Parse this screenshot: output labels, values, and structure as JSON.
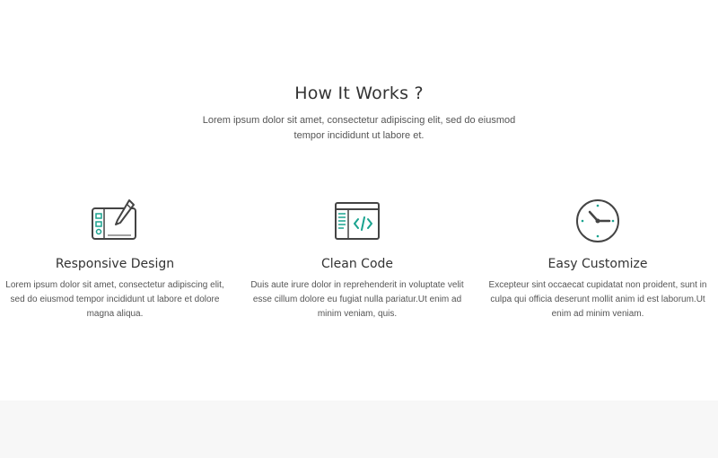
{
  "section": {
    "title": "How It Works ?",
    "lead": "Lorem ipsum dolor sit amet, consectetur adipiscing elit, sed do eiusmod tempor incididunt ut labore et."
  },
  "features": [
    {
      "icon": "tablet-pen-icon",
      "title": "Responsive Design",
      "text": "Lorem ipsum dolor sit amet, consectetur adipiscing elit, sed do eiusmod tempor incididunt ut labore et dolore magna aliqua."
    },
    {
      "icon": "code-window-icon",
      "title": "Clean Code",
      "text": "Duis aute irure dolor in reprehenderit in voluptate velit esse cillum dolore eu fugiat nulla pariatur.Ut enim ad minim veniam, quis."
    },
    {
      "icon": "clock-icon",
      "title": "Easy Customize",
      "text": "Excepteur sint occaecat cupidatat non proident, sunt in culpa qui officia deserunt mollit anim id est laborum.Ut enim ad minim veniam."
    }
  ],
  "colors": {
    "icon_stroke": "#444444",
    "icon_accent": "#1aa38f",
    "heading": "#333333",
    "body_text": "#555555",
    "footer_band": "#f7f7f7"
  }
}
